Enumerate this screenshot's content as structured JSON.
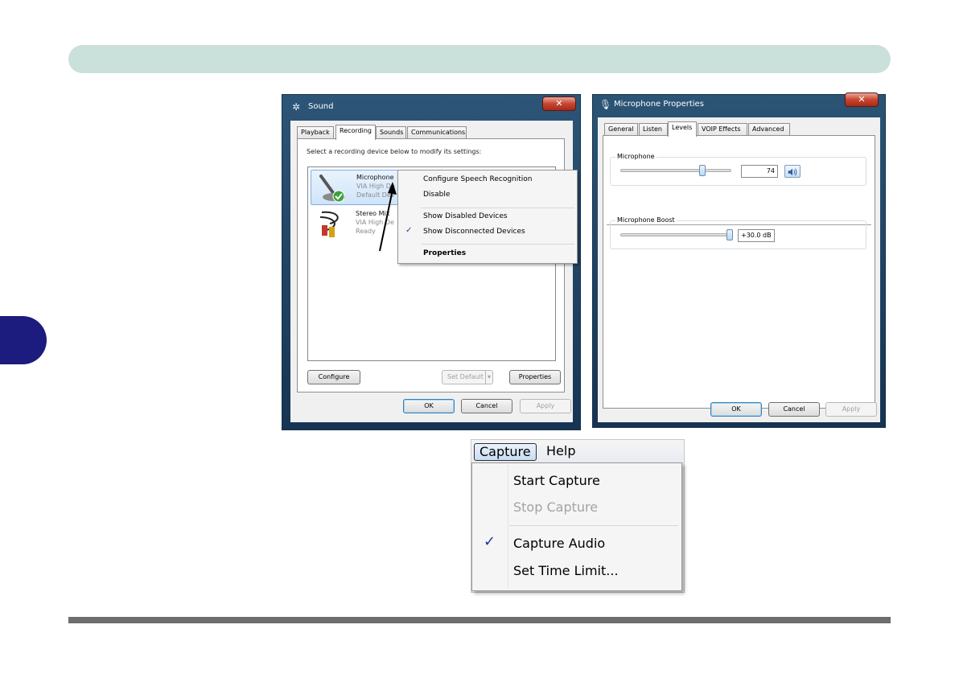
{
  "sound_dialog": {
    "title": "Sound",
    "tabs": [
      "Playback",
      "Recording",
      "Sounds",
      "Communications"
    ],
    "active_tab": "Recording",
    "instruction": "Select a recording device below to modify its settings:",
    "devices": [
      {
        "name": "Microphone",
        "driver": "VIA High De",
        "status": "Default Dev"
      },
      {
        "name": "Stereo Mix",
        "driver": "VIA High De",
        "status": "Ready"
      }
    ],
    "buttons": {
      "configure": "Configure",
      "set_default": "Set Default",
      "properties": "Properties",
      "ok": "OK",
      "cancel": "Cancel",
      "apply": "Apply"
    }
  },
  "context_menu": {
    "items": [
      {
        "label": "Configure Speech Recognition",
        "bold": false,
        "checked": false
      },
      {
        "label": "Disable",
        "bold": false,
        "checked": false
      },
      {
        "label": "Show Disabled Devices",
        "bold": false,
        "checked": false
      },
      {
        "label": "Show Disconnected Devices",
        "bold": false,
        "checked": true
      },
      {
        "label": "Properties",
        "bold": true,
        "checked": false
      }
    ],
    "check_glyph": "✓"
  },
  "mic_dialog": {
    "title": "Microphone Properties",
    "tabs": [
      "General",
      "Listen",
      "Levels",
      "VOIP Effects",
      "Advanced"
    ],
    "active_tab": "Levels",
    "microphone_label": "Microphone",
    "microphone_value": "74",
    "microphone_level": 0.74,
    "boost_label": "Microphone Boost",
    "boost_value": "+30.0 dB",
    "boost_level": 1.0,
    "buttons": {
      "ok": "OK",
      "cancel": "Cancel",
      "apply": "Apply"
    }
  },
  "capture_app": {
    "menus": [
      "Capture",
      "Help"
    ],
    "open_menu": "Capture",
    "items": [
      {
        "label": "Start Capture",
        "enabled": true,
        "checked": false
      },
      {
        "label": "Stop Capture",
        "enabled": false,
        "checked": false
      },
      {
        "label": "Capture Audio",
        "enabled": true,
        "checked": true
      },
      {
        "label": "Set Time Limit...",
        "enabled": true,
        "checked": false
      }
    ],
    "check_glyph": "✓"
  },
  "colors": {
    "banner": "#c9e1da",
    "side_tab": "#1c1b7e",
    "window_frame": "#1f3f62",
    "close_button": "#c8452f",
    "checkmark": "#1a3a9a"
  }
}
